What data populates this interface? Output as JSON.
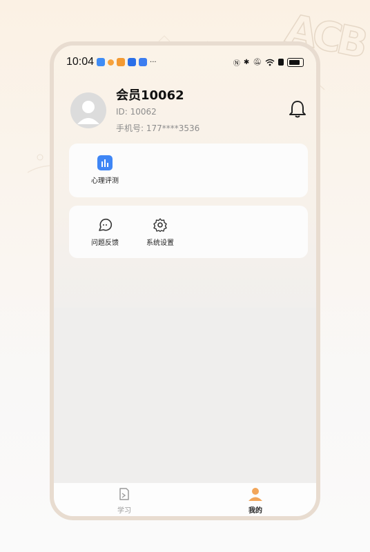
{
  "status": {
    "time": "10:04",
    "more": "···"
  },
  "profile": {
    "name": "会员10062",
    "id_text": "ID:  10062",
    "phone_text": "手机号:  177****3536"
  },
  "card1": {
    "items": [
      {
        "label": "心理评测",
        "icon": "chart-icon"
      }
    ]
  },
  "card2": {
    "items": [
      {
        "label": "问题反馈",
        "icon": "feedback-icon"
      },
      {
        "label": "系统设置",
        "icon": "gear-icon"
      }
    ]
  },
  "tabs": [
    {
      "label": "学习",
      "icon": "study-icon",
      "active": false
    },
    {
      "label": "我的",
      "icon": "profile-icon",
      "active": true
    }
  ],
  "colors": {
    "accent": "#f2a65a",
    "chart_blue": "#3f86f5",
    "inactive": "#9a9a9a"
  }
}
